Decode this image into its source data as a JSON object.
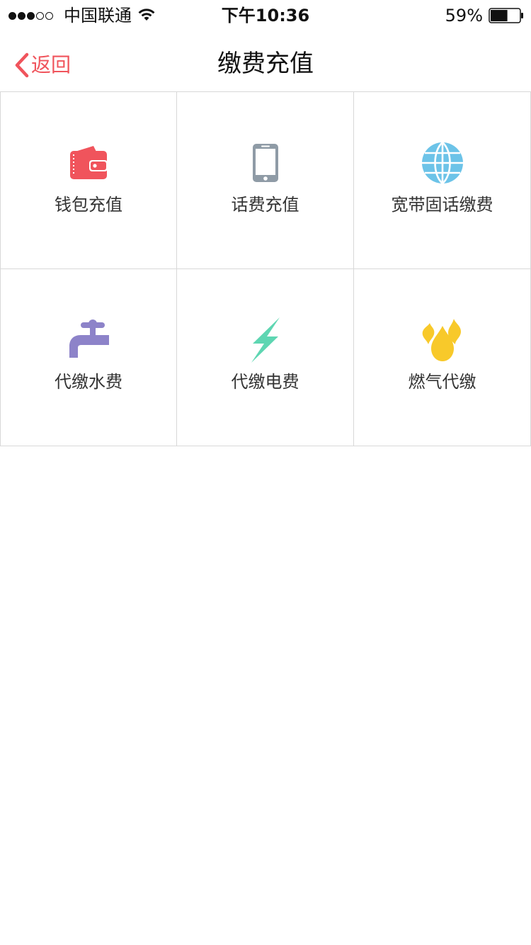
{
  "status_bar": {
    "signal_dots": 5,
    "signal_filled": 3,
    "carrier": "中国联通",
    "time": "下午10:36",
    "battery_percent_text": "59%",
    "battery_level": 0.59
  },
  "nav": {
    "back_label": "返回",
    "title": "缴费充值"
  },
  "colors": {
    "accent": "#f0545c",
    "wallet": "#f0545c",
    "phone": "#8f9ba6",
    "broadband": "#6cc3e8",
    "water": "#8d83c9",
    "electric": "#5ed6b2",
    "gas": "#f8c92a",
    "grid_line": "#d8d8d8"
  },
  "services": [
    {
      "id": "wallet",
      "label": "钱包充值",
      "icon": "wallet-icon"
    },
    {
      "id": "phone",
      "label": "话费充值",
      "icon": "phone-icon"
    },
    {
      "id": "broadband",
      "label": "宽带固话缴费",
      "icon": "globe-icon"
    },
    {
      "id": "water",
      "label": "代缴水费",
      "icon": "faucet-icon"
    },
    {
      "id": "electric",
      "label": "代缴电费",
      "icon": "lightning-icon"
    },
    {
      "id": "gas",
      "label": "燃气代缴",
      "icon": "flame-icon"
    }
  ]
}
